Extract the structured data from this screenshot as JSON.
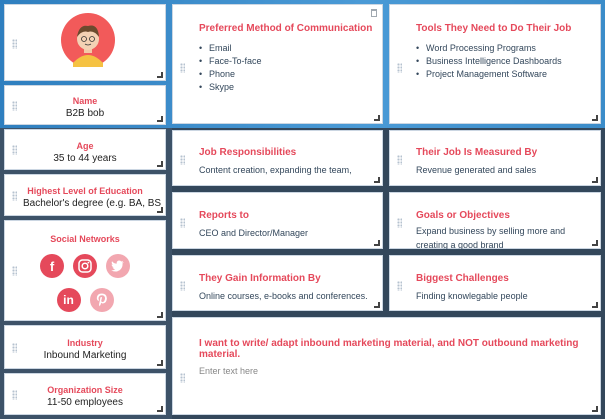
{
  "left": {
    "name_label": "Name",
    "name_value": "B2B bob",
    "age_label": "Age",
    "age_value": "35 to 44 years",
    "education_label": "Highest Level of Education",
    "education_value": "Bachelor's degree (e.g. BA, BS",
    "social_label": "Social Networks",
    "social_icons": [
      "facebook-icon",
      "instagram-icon",
      "twitter-icon",
      "linkedin-icon",
      "pinterest-icon"
    ],
    "industry_label": "Industry",
    "industry_value": "Inbound Marketing",
    "org_label": "Organization Size",
    "org_value": "11-50 employees"
  },
  "communication": {
    "title": "Preferred Method of Communication",
    "items": [
      "Email",
      "Face-To-face",
      "Phone",
      "Skype"
    ]
  },
  "tools": {
    "title": "Tools They Need to Do Their Job",
    "items": [
      "Word Processing Programs",
      "Business Intelligence Dashboards",
      "Project Management Software"
    ]
  },
  "responsibilities": {
    "title": "Job Responsibilities",
    "text": "Content creation, expanding the team,"
  },
  "measured": {
    "title": "Their Job Is Measured By",
    "text": "Revenue generated and sales"
  },
  "reports": {
    "title": "Reports to",
    "text": "CEO and Director/Manager"
  },
  "goals": {
    "title": "Goals or Objectives",
    "text_line1": "Expand business by selling more and",
    "text_line2": "creating a good brand"
  },
  "info": {
    "title": "They Gain Information By",
    "text": "Online courses, e-books and conferences."
  },
  "challenges": {
    "title": "Biggest Challenges",
    "text": "Finding knowlegable people"
  },
  "statement": {
    "title": "I want to write/ adapt inbound marketing material, and NOT outbound marketing material.",
    "placeholder": "Enter text here"
  },
  "colors": {
    "accent": "#e5495b",
    "social": "#e5495b",
    "social_light": "#f2a7b0",
    "bg_dark": "#33475b",
    "bg_blue": "#3b8cc9"
  }
}
